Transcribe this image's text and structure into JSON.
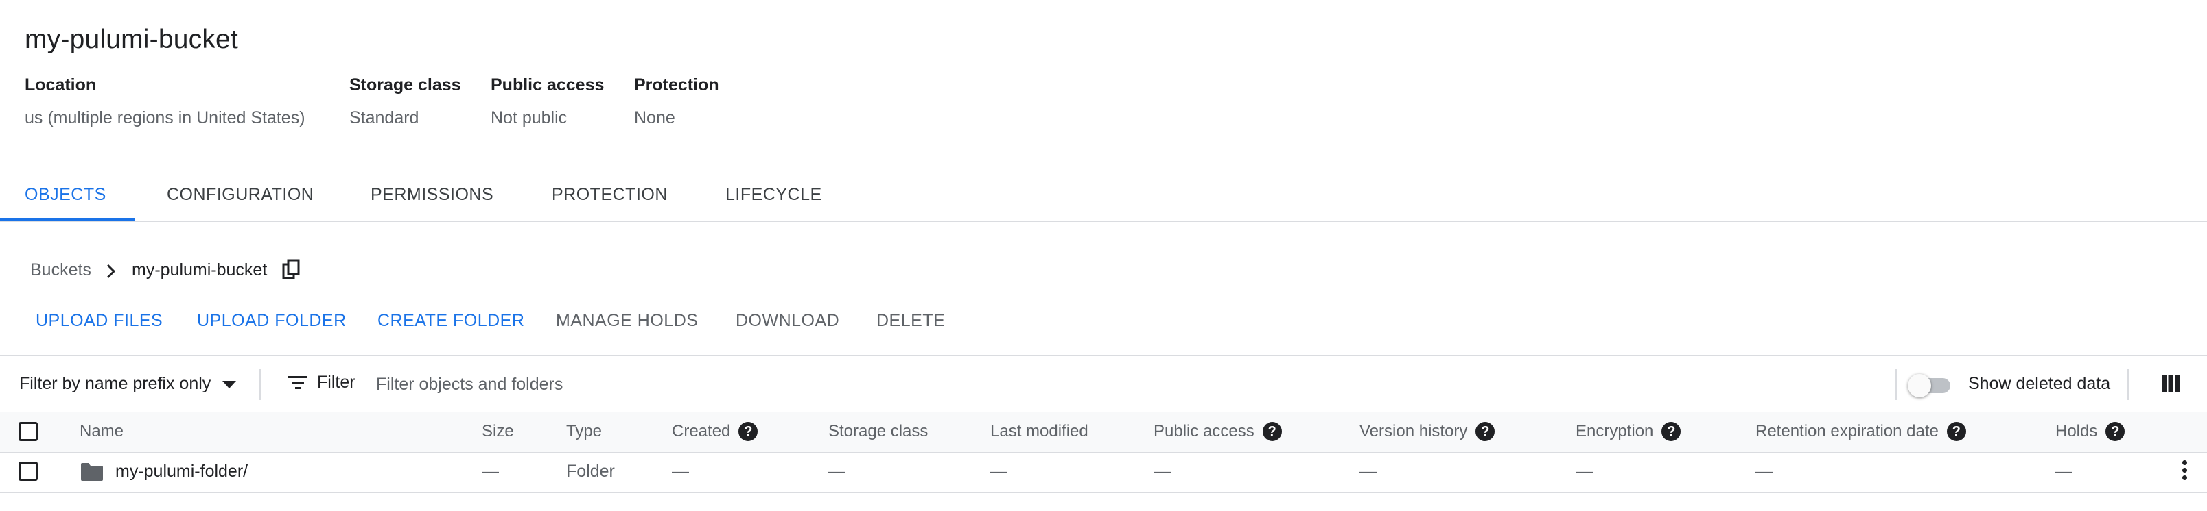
{
  "bucket": {
    "title": "my-pulumi-bucket"
  },
  "details": [
    {
      "label": "Location",
      "value": "us (multiple regions in United States)"
    },
    {
      "label": "Storage class",
      "value": "Standard"
    },
    {
      "label": "Public access",
      "value": "Not public"
    },
    {
      "label": "Protection",
      "value": "None"
    }
  ],
  "tabs": [
    {
      "label": "OBJECTS",
      "active": true
    },
    {
      "label": "CONFIGURATION"
    },
    {
      "label": "PERMISSIONS"
    },
    {
      "label": "PROTECTION"
    },
    {
      "label": "LIFECYCLE"
    }
  ],
  "breadcrumb": {
    "root": "Buckets",
    "current": "my-pulumi-bucket",
    "separator_icon": "chevron-right-icon",
    "copy_icon": "copy-icon"
  },
  "actions": [
    {
      "label": "UPLOAD FILES",
      "enabled": true
    },
    {
      "label": "UPLOAD FOLDER",
      "enabled": true
    },
    {
      "label": "CREATE FOLDER",
      "enabled": true
    },
    {
      "label": "MANAGE HOLDS",
      "enabled": false
    },
    {
      "label": "DOWNLOAD",
      "enabled": false
    },
    {
      "label": "DELETE",
      "enabled": false
    }
  ],
  "filter": {
    "mode_label": "Filter by name prefix only",
    "button_label": "Filter",
    "placeholder": "Filter objects and folders",
    "show_deleted_label": "Show deleted data",
    "show_deleted_on": false
  },
  "table": {
    "columns": [
      {
        "label": "Name",
        "help": false
      },
      {
        "label": "Size",
        "help": false
      },
      {
        "label": "Type",
        "help": false
      },
      {
        "label": "Created",
        "help": true
      },
      {
        "label": "Storage class",
        "help": false
      },
      {
        "label": "Last modified",
        "help": false
      },
      {
        "label": "Public access",
        "help": true
      },
      {
        "label": "Version history",
        "help": true
      },
      {
        "label": "Encryption",
        "help": true
      },
      {
        "label": "Retention expiration date",
        "help": true
      },
      {
        "label": "Holds",
        "help": true
      }
    ],
    "help_glyph": "?",
    "rows": [
      {
        "name": "my-pulumi-folder/",
        "icon": "folder-icon",
        "size": "—",
        "type": "Folder",
        "created": "—",
        "storage_class": "—",
        "last_modified": "—",
        "public_access": "—",
        "version_history": "—",
        "encryption": "—",
        "retention_expiration": "—",
        "holds": "—"
      }
    ]
  },
  "colors": {
    "accent": "#1a73e8",
    "text": "#202124",
    "muted": "#5f6368",
    "border": "#dadce0",
    "header_bg": "#f8f9fa"
  }
}
